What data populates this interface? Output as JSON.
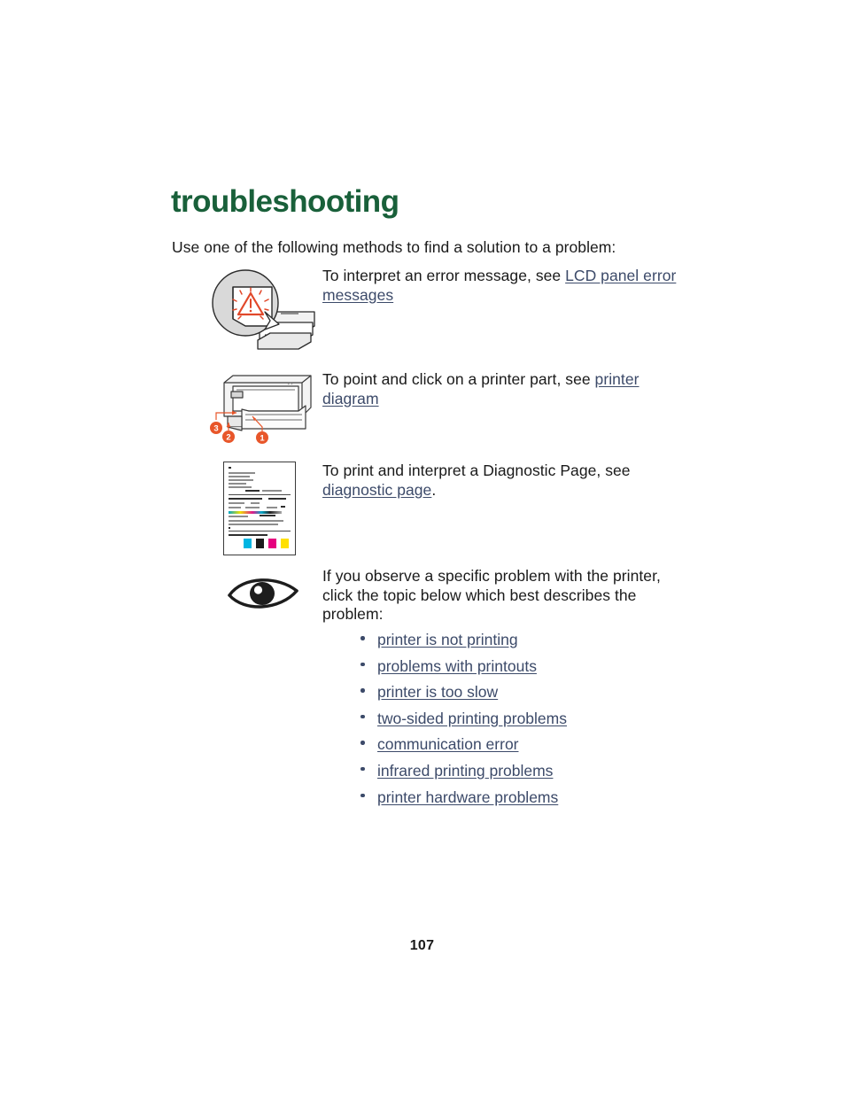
{
  "document": {
    "title": "troubleshooting",
    "intro": "Use one of the following methods to find a solution to a problem:",
    "page_number": "107",
    "title_color": "#19603a",
    "link_color": "#3c4a69",
    "callout_color": "#e8562a",
    "body_color": "#1a1a1a"
  },
  "methods": [
    {
      "icon": "lcd-panel-error-illustration",
      "text_before": "To interpret an error message, see ",
      "link": "LCD panel error messages",
      "text_after": ""
    },
    {
      "icon": "printer-diagram-illustration",
      "text_before": "To point and click on a printer part, see ",
      "link": "printer diagram",
      "text_after": "",
      "callouts": [
        "3",
        "2",
        "1"
      ]
    },
    {
      "icon": "diagnostic-page-thumbnail",
      "text_before": "To print and interpret a Diagnostic Page, see ",
      "link": "diagnostic page",
      "text_after": "."
    },
    {
      "icon": "eye-illustration",
      "text_before": "If you observe a specific problem with the printer, click the topic below which best describes the problem:",
      "link": "",
      "text_after": ""
    }
  ],
  "symptom_links": [
    "printer is not printing",
    "problems with printouts",
    "printer is too slow",
    "two-sided printing problems",
    "communication error",
    "infrared printing problems",
    "printer hardware problems"
  ]
}
